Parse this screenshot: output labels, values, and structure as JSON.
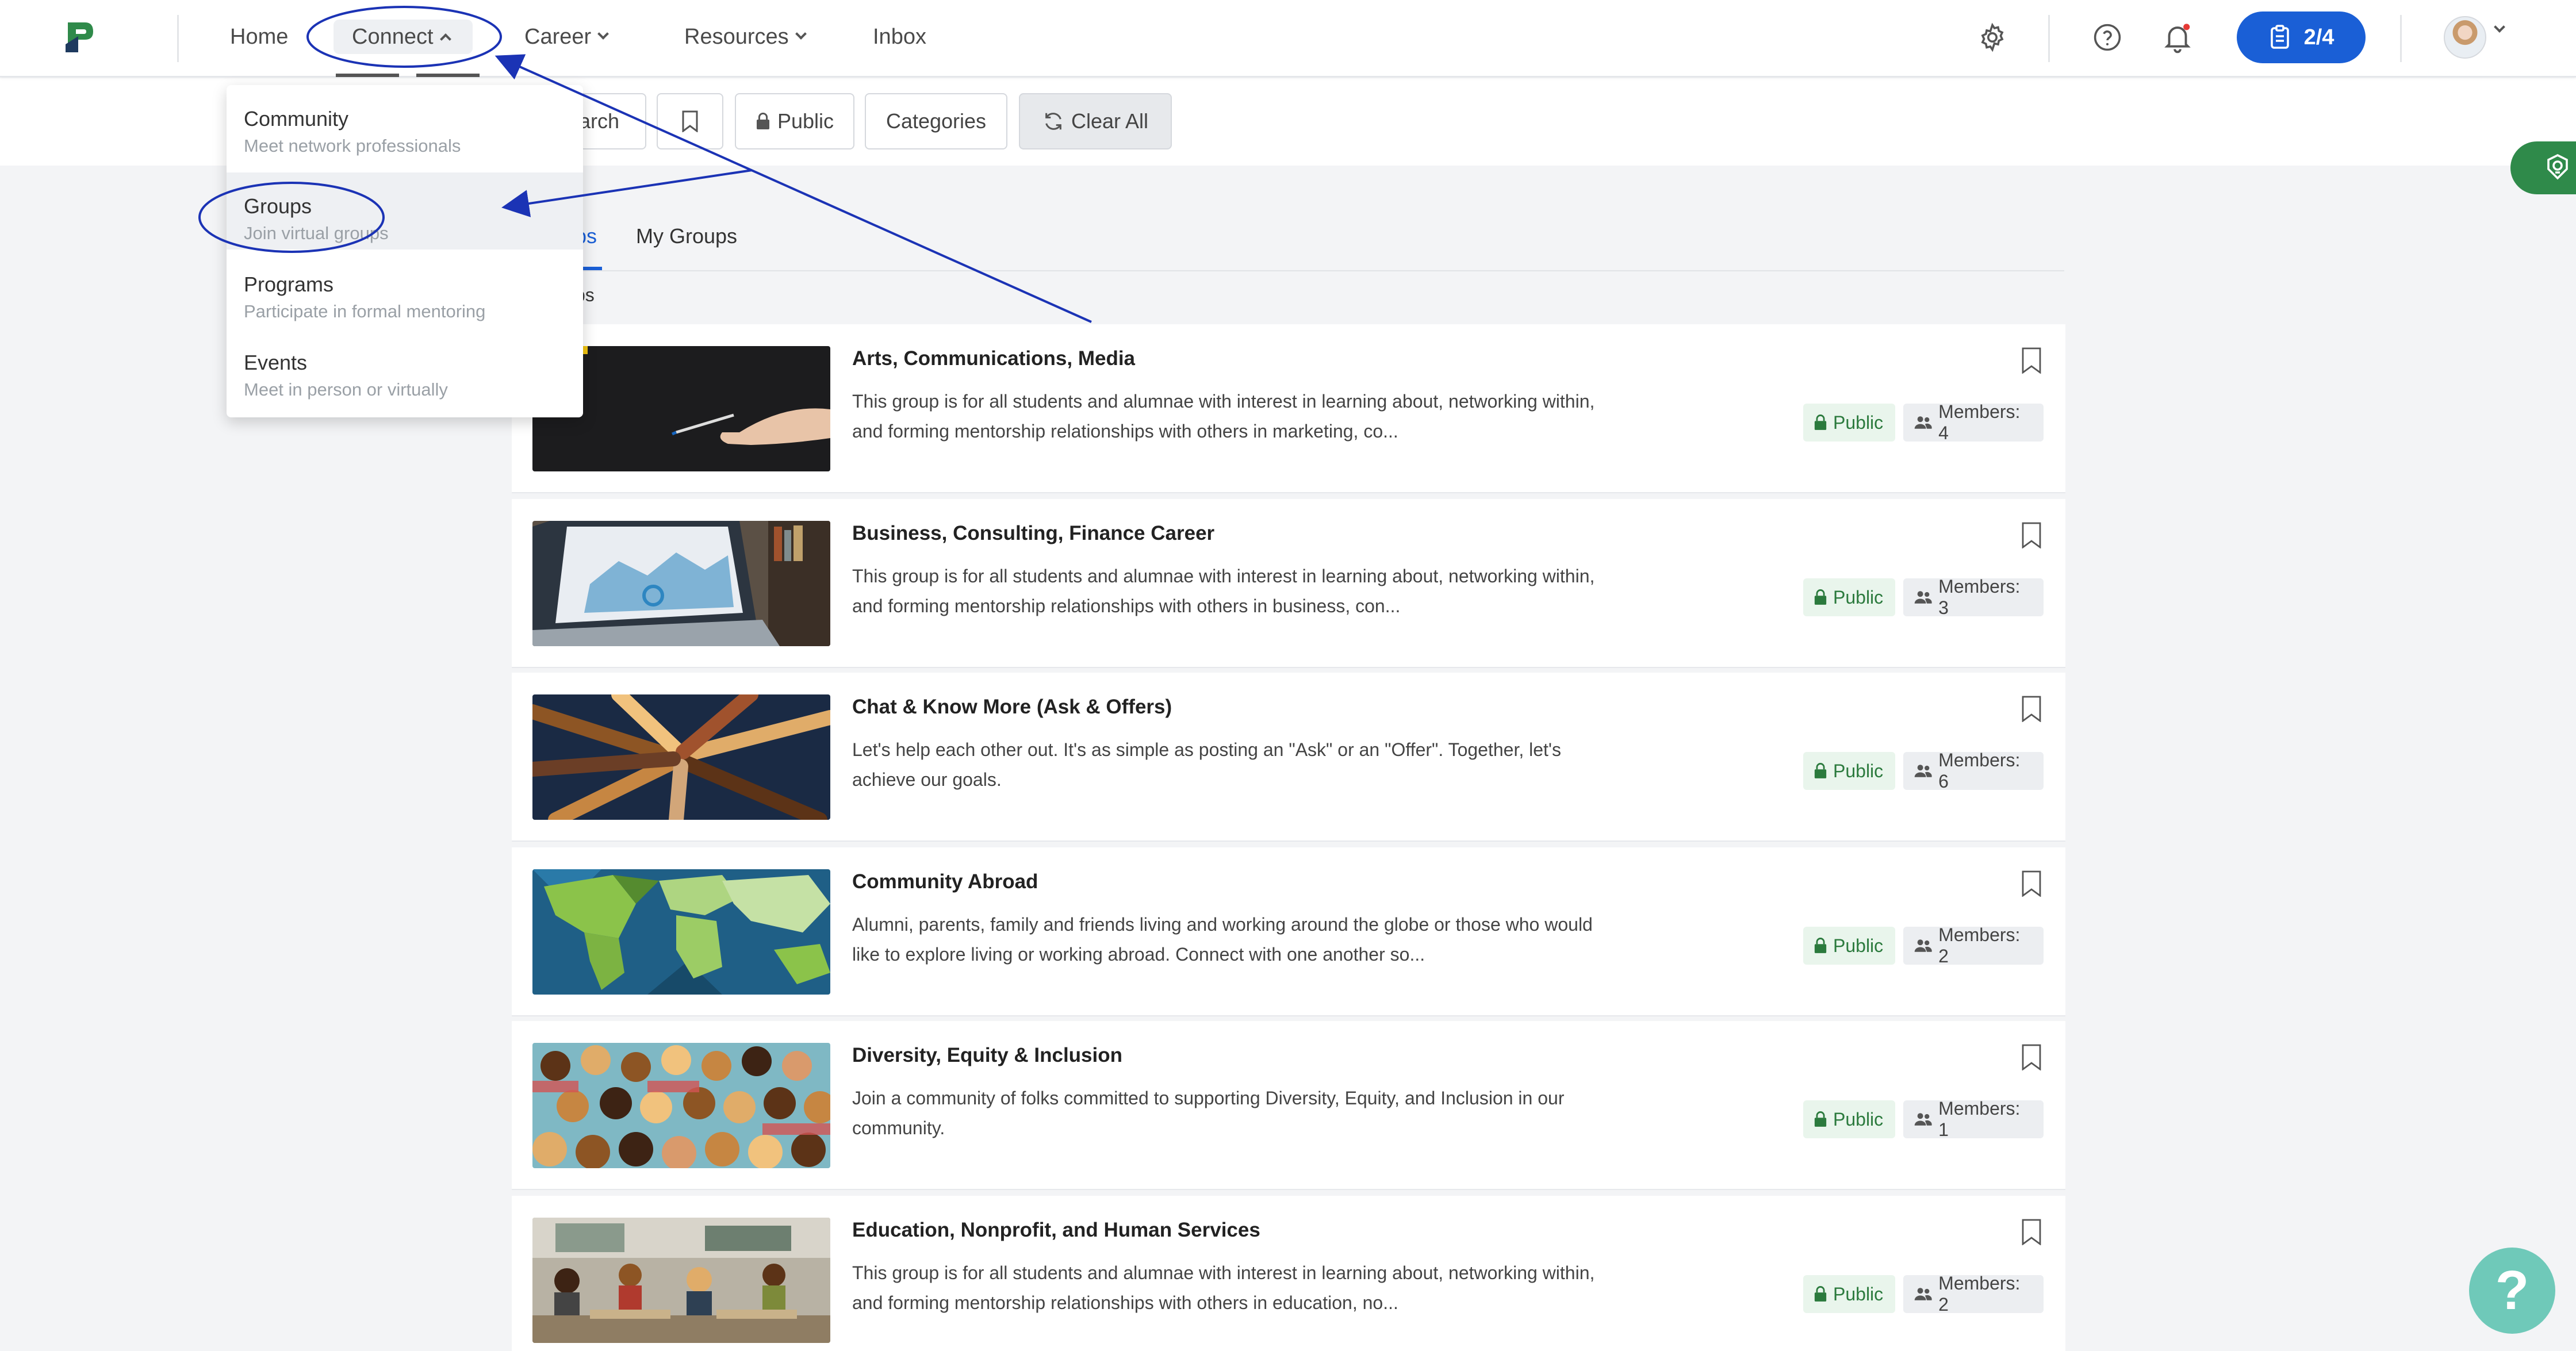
{
  "nav": {
    "home": "Home",
    "connect": "Connect",
    "career": "Career",
    "resources": "Resources",
    "inbox": "Inbox",
    "progress": "2/4",
    "colors": {
      "primary": "#1a5fd6",
      "accent_green": "#2f8a4a",
      "badge_green": "#2b7a3d"
    },
    "icons": [
      "logo-icon",
      "gear-icon",
      "help-circle-icon",
      "bell-icon",
      "clipboard-icon",
      "avatar",
      "chevron-down-icon"
    ]
  },
  "filters": {
    "search_partial": "arch",
    "public": "Public",
    "categories": "Categories",
    "clear_all": "Clear All"
  },
  "dropdown": {
    "items": [
      {
        "label": "Community",
        "sub": "Meet network professionals"
      },
      {
        "label": "Groups",
        "sub": "Join virtual groups"
      },
      {
        "label": "Programs",
        "sub": "Participate in formal mentoring"
      },
      {
        "label": "Events",
        "sub": "Meet in person or virtually"
      }
    ]
  },
  "tabs": {
    "all_partial": "ps",
    "my_groups": "My Groups",
    "results_partial": "ps"
  },
  "groups": [
    {
      "title": "Arts, Communications, Media",
      "desc": "This group is for all students and alumnae with interest in learning about, networking within, and forming mentorship relationships with others in marketing, co...",
      "public": "Public",
      "members": "Members: 4"
    },
    {
      "title": "Business, Consulting, Finance Career",
      "desc": "This group is for all students and alumnae with interest in learning about, networking within, and forming mentorship relationships with others in business, con...",
      "public": "Public",
      "members": "Members: 3"
    },
    {
      "title": "Chat & Know More (Ask & Offers)",
      "desc": "Let's help each other out. It's as simple as posting an \"Ask\" or an \"Offer\". Together, let's achieve our goals.",
      "public": "Public",
      "members": "Members: 6"
    },
    {
      "title": "Community Abroad",
      "desc": "Alumni, parents, family and friends living and working around the globe or those who would like to explore living or working abroad. Connect with one another so...",
      "public": "Public",
      "members": "Members: 2"
    },
    {
      "title": "Diversity, Equity & Inclusion",
      "desc": "Join a community of folks committed to supporting Diversity, Equity, and Inclusion in our community.",
      "public": "Public",
      "members": "Members: 1"
    },
    {
      "title": "Education, Nonprofit, and Human Services",
      "desc": "This group is for all students and alumnae with interest in learning about, networking within, and forming mentorship relationships with others in education, no...",
      "public": "Public",
      "members": "Members: 2"
    }
  ],
  "help": "?"
}
